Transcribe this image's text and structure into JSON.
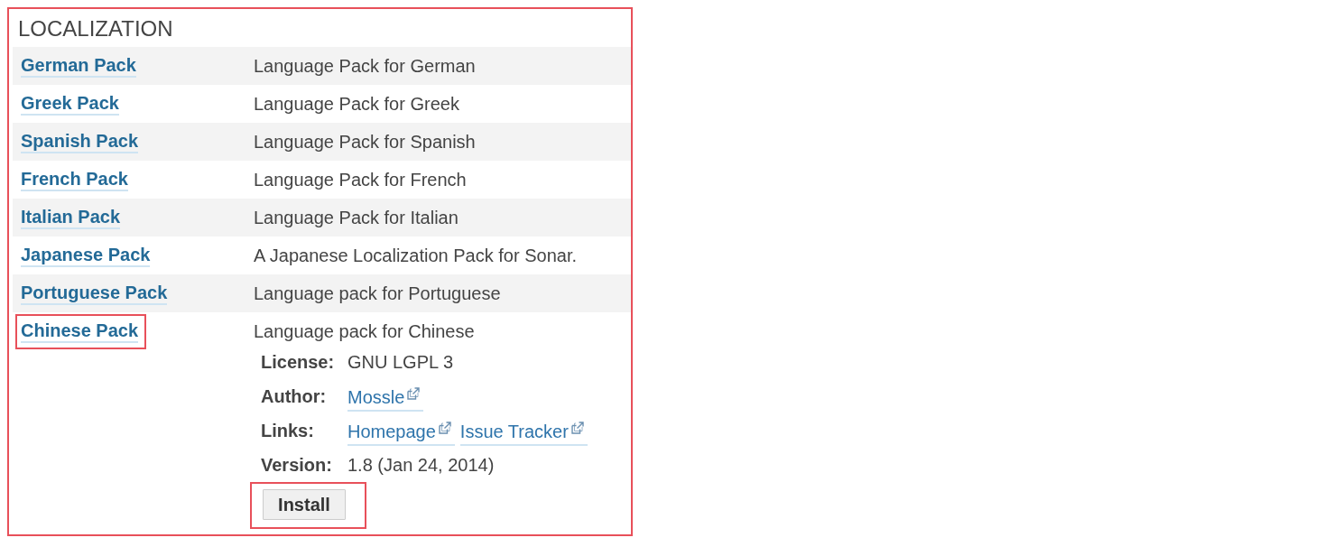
{
  "section": {
    "title": "LOCALIZATION",
    "highlighted": true
  },
  "packs": [
    {
      "name": "German Pack",
      "description": "Language Pack for German",
      "highlighted": false
    },
    {
      "name": "Greek Pack",
      "description": "Language Pack for Greek",
      "highlighted": false
    },
    {
      "name": "Spanish Pack",
      "description": "Language Pack for Spanish",
      "highlighted": false
    },
    {
      "name": "French Pack",
      "description": "Language Pack for French",
      "highlighted": false
    },
    {
      "name": "Italian Pack",
      "description": "Language Pack for Italian",
      "highlighted": false
    },
    {
      "name": "Japanese Pack",
      "description": "A Japanese Localization Pack for Sonar.",
      "highlighted": false
    },
    {
      "name": "Portuguese Pack",
      "description": "Language pack for Portuguese",
      "highlighted": false
    },
    {
      "name": "Chinese Pack",
      "description": "Language pack for Chinese",
      "highlighted": true,
      "details": [
        {
          "label": "License:",
          "kind": "text",
          "value": "GNU LGPL 3"
        },
        {
          "label": "Author:",
          "kind": "links",
          "links": [
            "Mossle"
          ]
        },
        {
          "label": "Links:",
          "kind": "links",
          "links": [
            "Homepage",
            "Issue Tracker"
          ]
        },
        {
          "label": "Version:",
          "kind": "text",
          "value": "1.8 (Jan 24, 2014)"
        }
      ],
      "install_button": {
        "label": "Install",
        "highlighted": true
      }
    }
  ]
}
